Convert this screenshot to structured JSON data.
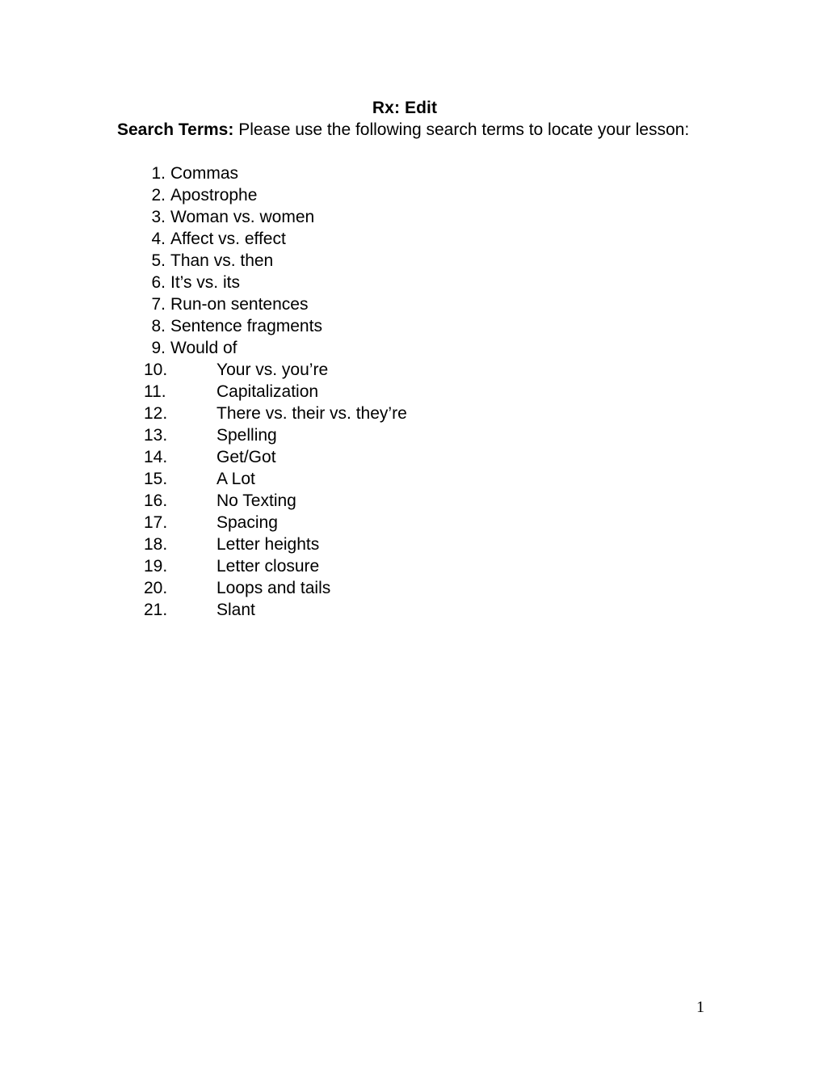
{
  "document": {
    "title": "Rx: Edit",
    "intro": {
      "lead": "Search Terms:",
      "body": " Please use the following search terms to locate your lesson:"
    },
    "search_terms": [
      {
        "number": "1.",
        "label": "Commas"
      },
      {
        "number": "2.",
        "label": "Apostrophe"
      },
      {
        "number": "3.",
        "label": "Woman vs. women"
      },
      {
        "number": "4.",
        "label": "Affect vs. effect"
      },
      {
        "number": "5.",
        "label": "Than vs. then"
      },
      {
        "number": "6.",
        "label": "It’s vs. its"
      },
      {
        "number": "7.",
        "label": "Run-on sentences"
      },
      {
        "number": "8.",
        "label": "Sentence fragments"
      },
      {
        "number": "9.",
        "label": "Would of"
      },
      {
        "number": "10.",
        "label": "Your vs. you’re"
      },
      {
        "number": "11.",
        "label": "Capitalization"
      },
      {
        "number": "12.",
        "label": "There vs. their vs. they’re"
      },
      {
        "number": "13.",
        "label": "Spelling"
      },
      {
        "number": "14.",
        "label": "Get/Got"
      },
      {
        "number": "15.",
        "label": "A Lot"
      },
      {
        "number": "16.",
        "label": "No Texting"
      },
      {
        "number": "17.",
        "label": "Spacing"
      },
      {
        "number": "18.",
        "label": "Letter heights"
      },
      {
        "number": "19.",
        "label": "Letter closure"
      },
      {
        "number": "20.",
        "label": "Loops and tails"
      },
      {
        "number": "21.",
        "label": "Slant"
      }
    ],
    "page_number": "1"
  }
}
